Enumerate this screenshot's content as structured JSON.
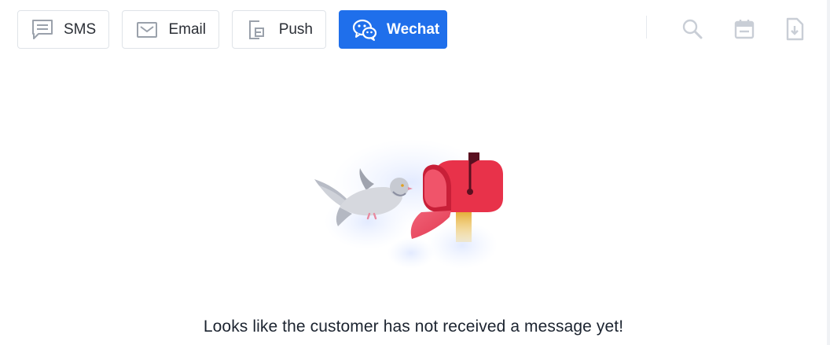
{
  "toolbar": {
    "channels": [
      {
        "label": "SMS",
        "icon": "sms-icon",
        "active": false
      },
      {
        "label": "Email",
        "icon": "email-icon",
        "active": false
      },
      {
        "label": "Push",
        "icon": "push-icon",
        "active": false
      },
      {
        "label": "Wechat",
        "icon": "wechat-icon",
        "active": true
      }
    ],
    "tools": [
      {
        "icon": "search-icon"
      },
      {
        "icon": "calendar-icon"
      },
      {
        "icon": "download-icon"
      }
    ]
  },
  "empty_state": {
    "message": "Looks like the customer has not received a message yet!",
    "illustration": "pigeon-mailbox-illustration"
  },
  "colors": {
    "accent": "#1f6feb",
    "text": "#1c2430",
    "icon_muted": "#c9ced6",
    "mailbox_red": "#e8324a"
  }
}
